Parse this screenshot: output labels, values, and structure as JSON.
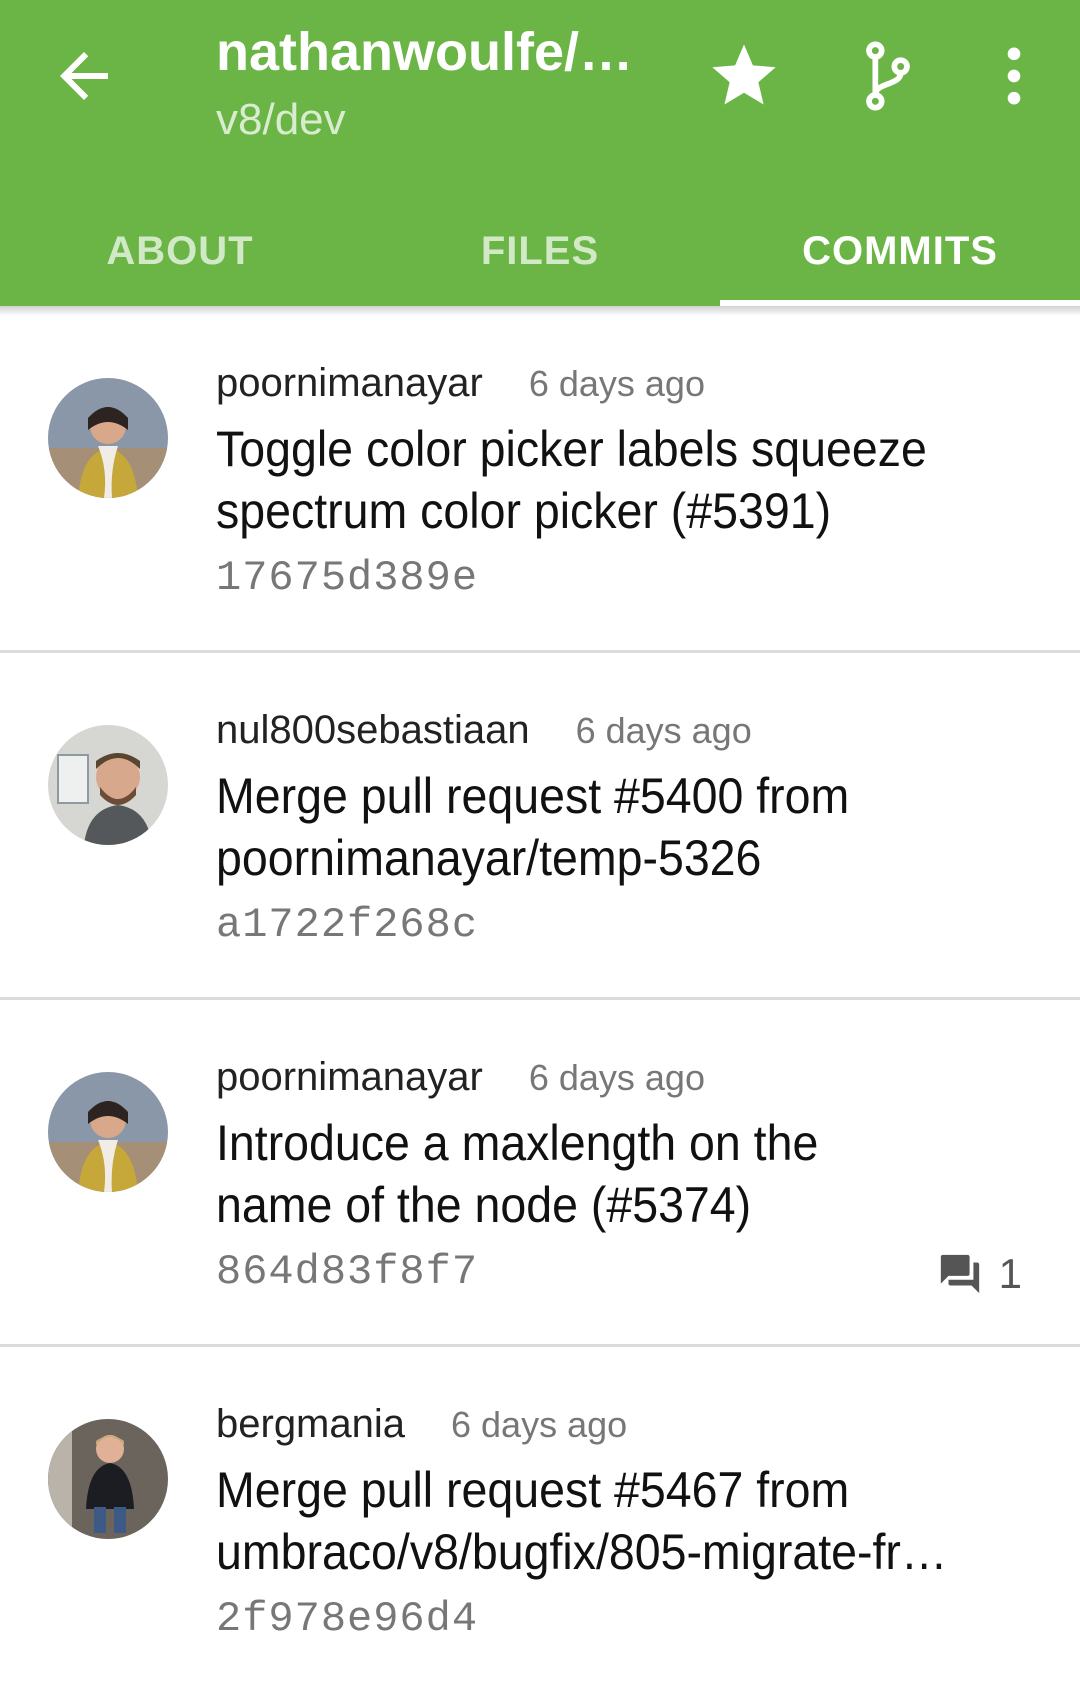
{
  "header": {
    "title": "nathanwoulfe/…",
    "subtitle": "v8/dev",
    "color": "#6ab545"
  },
  "tabs": [
    {
      "label": "ABOUT",
      "active": false
    },
    {
      "label": "FILES",
      "active": false
    },
    {
      "label": "COMMITS",
      "active": true
    }
  ],
  "commits": [
    {
      "author": "poornimanayar",
      "time": "6 days ago",
      "message_line1": "Toggle color picker labels squeeze",
      "message_line2": "spectrum color picker (#5391)",
      "sha": "17675d389e",
      "comments": null
    },
    {
      "author": "nul800sebastiaan",
      "time": "6 days ago",
      "message_line1": "Merge pull request #5400 from",
      "message_line2": "poornimanayar/temp-5326",
      "sha": "a1722f268c",
      "comments": null
    },
    {
      "author": "poornimanayar",
      "time": "6 days ago",
      "message_line1": "Introduce a maxlength on the",
      "message_line2": "name of the node (#5374)",
      "sha": "864d83f8f7",
      "comments": "1"
    },
    {
      "author": "bergmania",
      "time": "6 days ago",
      "message_line1": "Merge pull request #5467 from",
      "message_line2": "umbraco/v8/bugfix/805-migrate-fro…",
      "sha": "2f978e96d4",
      "comments": null
    }
  ]
}
